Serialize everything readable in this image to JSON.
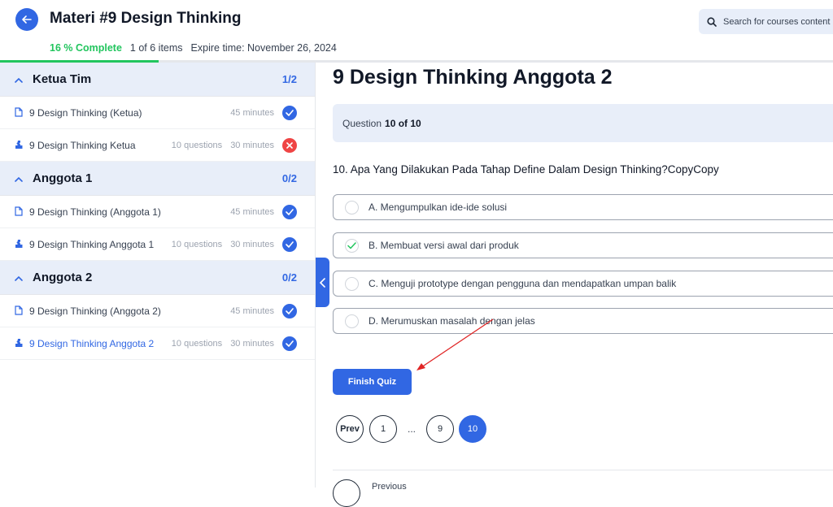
{
  "header": {
    "title": "Materi #9 Design Thinking",
    "complete": "16 % Complete",
    "items": "1 of 6 items",
    "expire": "Expire time: November 26, 2024",
    "search_placeholder": "Search for courses content ...",
    "progress_fraction": 0.19
  },
  "sidebar": {
    "sections": [
      {
        "title": "Ketua Tim",
        "count": "1/2",
        "items": [
          {
            "name": "9 Design Thinking (Ketua)",
            "info1": "",
            "info2": "45 minutes",
            "status": "done",
            "type": "doc"
          },
          {
            "name": "9 Design Thinking Ketua",
            "info1": "10 questions",
            "info2": "30 minutes",
            "status": "fail",
            "type": "quiz"
          }
        ]
      },
      {
        "title": "Anggota 1",
        "count": "0/2",
        "items": [
          {
            "name": "9 Design Thinking (Anggota 1)",
            "info1": "",
            "info2": "45 minutes",
            "status": "done",
            "type": "doc"
          },
          {
            "name": "9 Design Thinking Anggota 1",
            "info1": "10 questions",
            "info2": "30 minutes",
            "status": "done",
            "type": "quiz"
          }
        ]
      },
      {
        "title": "Anggota 2",
        "count": "0/2",
        "items": [
          {
            "name": "9 Design Thinking (Anggota 2)",
            "info1": "",
            "info2": "45 minutes",
            "status": "done",
            "type": "doc"
          },
          {
            "name": "9 Design Thinking Anggota 2",
            "info1": "10 questions",
            "info2": "30 minutes",
            "status": "done",
            "type": "quiz"
          }
        ]
      }
    ]
  },
  "main": {
    "lesson_title": "9 Design Thinking Anggota 2",
    "question_label": "Question",
    "question_progress": "10 of 10",
    "question_text": "10. Apa Yang Dilakukan Pada Tahap Define Dalam Design Thinking?CopyCopy",
    "options": [
      {
        "label": "A. Mengumpulkan ide-ide solusi",
        "checked": false
      },
      {
        "label": "B. Membuat versi awal dari produk",
        "checked": true
      },
      {
        "label": "C. Menguji prototype dengan pengguna dan mendapatkan umpan balik",
        "checked": false
      },
      {
        "label": "D. Merumuskan masalah dengan jelas",
        "checked": false
      }
    ],
    "finish_label": "Finish Quiz",
    "pager": {
      "prev": "Prev",
      "p1": "1",
      "dots": "...",
      "p9": "9",
      "p10": "10"
    },
    "previous_label": "Previous"
  },
  "colors": {
    "accent": "#3167e3",
    "success": "#22c55e",
    "danger": "#ef4444",
    "annotation": "#e02424"
  }
}
